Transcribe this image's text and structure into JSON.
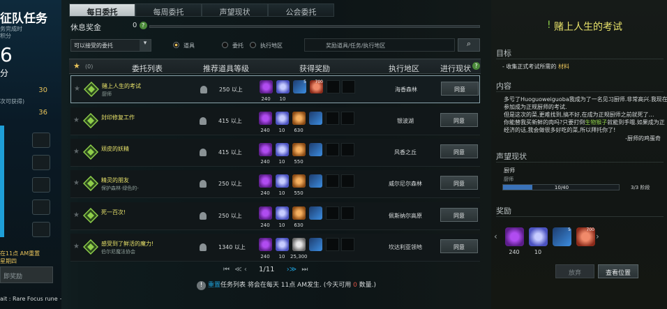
{
  "left_panel": {
    "title": "征队任务",
    "sub1": "务完成时",
    "sub2": "积分",
    "big_number": "6",
    "big_unit": "分",
    "row1_label": "",
    "row1_value": "30",
    "row2_label": "次可获得)",
    "row2_value": "36",
    "reset_line1": "在11点 AM重置",
    "reset_line2": "星期四",
    "button_label": "即奖励"
  },
  "footer_chat": "ait : Rare Focus rune + Feast in my",
  "tabs": [
    {
      "label": "每日委托",
      "active": true
    },
    {
      "label": "每周委托",
      "active": false
    },
    {
      "label": "声望现状",
      "active": false
    },
    {
      "label": "公会委托",
      "active": false
    }
  ],
  "rest_reward": {
    "label": "休息奖金",
    "value": "0"
  },
  "filter": {
    "selected": "可以接受的委托"
  },
  "radios": [
    {
      "label": "道具",
      "checked": true
    },
    {
      "label": "委托",
      "checked": false
    },
    {
      "label": "执行地区",
      "checked": false
    }
  ],
  "search": {
    "placeholder": "奖励道具/任务/执行地区"
  },
  "table": {
    "star_count": "(0)",
    "headers": {
      "list": "委托列表",
      "level": "推荐道具等级",
      "reward": "获得奖励",
      "region": "执行地区",
      "status": "进行现状"
    },
    "rows": [
      {
        "name": "赌上人生的考试",
        "sub": "厨师",
        "level": "250 以上",
        "region": "海香森林",
        "accept": "同意",
        "selected": true,
        "rewards": [
          {
            "type": "purple",
            "count": "240"
          },
          {
            "type": "heart",
            "count": "10"
          },
          {
            "type": "potion",
            "count": "",
            "badge": "5"
          },
          {
            "type": "meat",
            "count": "",
            "badge": "700"
          }
        ]
      },
      {
        "name": "封印修复工作",
        "sub": "",
        "level": "415 以上",
        "region": "银波湖",
        "accept": "同意",
        "selected": false,
        "rewards": [
          {
            "type": "purple",
            "count": "240"
          },
          {
            "type": "heart",
            "count": "10"
          },
          {
            "type": "orange",
            "count": "630"
          },
          {
            "type": "potion",
            "count": ""
          }
        ]
      },
      {
        "name": "顽皮的妖精",
        "sub": "",
        "level": "415 以上",
        "region": "风香之丘",
        "accept": "同意",
        "selected": false,
        "rewards": [
          {
            "type": "purple",
            "count": "240"
          },
          {
            "type": "heart",
            "count": "10"
          },
          {
            "type": "orange",
            "count": "550"
          },
          {
            "type": "potion",
            "count": ""
          }
        ]
      },
      {
        "name": "精灵的朋友",
        "sub": "保护森林·绿色的-",
        "level": "250 以上",
        "region": "威尔尼尔森林",
        "accept": "同意",
        "selected": false,
        "rewards": [
          {
            "type": "purple",
            "count": "240"
          },
          {
            "type": "heart",
            "count": "10"
          },
          {
            "type": "orange",
            "count": "550"
          },
          {
            "type": "potion",
            "count": ""
          }
        ]
      },
      {
        "name": "死一百次!",
        "sub": "",
        "level": "250 以上",
        "region": "佩斯纳尔高原",
        "accept": "同意",
        "selected": false,
        "rewards": [
          {
            "type": "purple",
            "count": "240"
          },
          {
            "type": "heart",
            "count": "10"
          },
          {
            "type": "orange",
            "count": "630"
          },
          {
            "type": "potion",
            "count": ""
          }
        ]
      },
      {
        "name": "感受到了鲜活的魔力!",
        "sub": "伯尔尼魔法协会",
        "level": "1340 以上",
        "region": "坎达利亚领地",
        "accept": "同意",
        "selected": false,
        "rewards": [
          {
            "type": "purple",
            "count": "240"
          },
          {
            "type": "heart",
            "count": "10"
          },
          {
            "type": "coin",
            "count": "25,300"
          },
          {
            "type": "potion",
            "count": ""
          }
        ]
      }
    ]
  },
  "pager": {
    "first": "⏮",
    "prev": "≪ ‹",
    "page": "1/11",
    "next": "›≫",
    "last": "⏭"
  },
  "notice": {
    "pre": "重置",
    "mid": "任务列表 将会在每天 11点 AM发生. (今天可用 ",
    "zero": "0",
    "post": " 数量.)"
  },
  "detail": {
    "title": "赌上人生的考试",
    "goal_header": "目标",
    "goal_pre": "- 收集正式考试所需的 ",
    "goal_item": "材料",
    "content_header": "内容",
    "content_lines": [
      "多亏了Huoguoweiguoba我成为了一名见习厨师.非常高兴.我现在",
      "参加成为正规厨师的考试.",
      "但是这次的菜,更难找到,搞不好,在成为正规厨师之前就死了…",
      "你能替我买新鲜的肉吗?只要打倒生物猴子就能到手哦.如果成为正",
      "经济的话,我会做很多好吃的菜,所以拜托你了!"
    ],
    "content_green_word": "生物猴子",
    "signature": "-厨师的鸡蛋奇",
    "rep_header": "声望现状",
    "rep_name": "厨师",
    "rep_sub": "厨师",
    "rep_progress_text": "10/40",
    "rep_progress": 0.25,
    "rep_stage": "3/3 阶段",
    "reward_header": "奖励",
    "reward_counts": [
      "240",
      "10",
      "",
      ""
    ],
    "reward_badges": [
      "",
      "",
      "5",
      "700"
    ],
    "abandon_label": "放弃",
    "view_label": "查看位置"
  },
  "colors": {
    "accent_yellow": "#e8e26a",
    "accent_blue": "#1e9fd8",
    "gold": "#e8c35a",
    "green": "#8fcf4a"
  }
}
